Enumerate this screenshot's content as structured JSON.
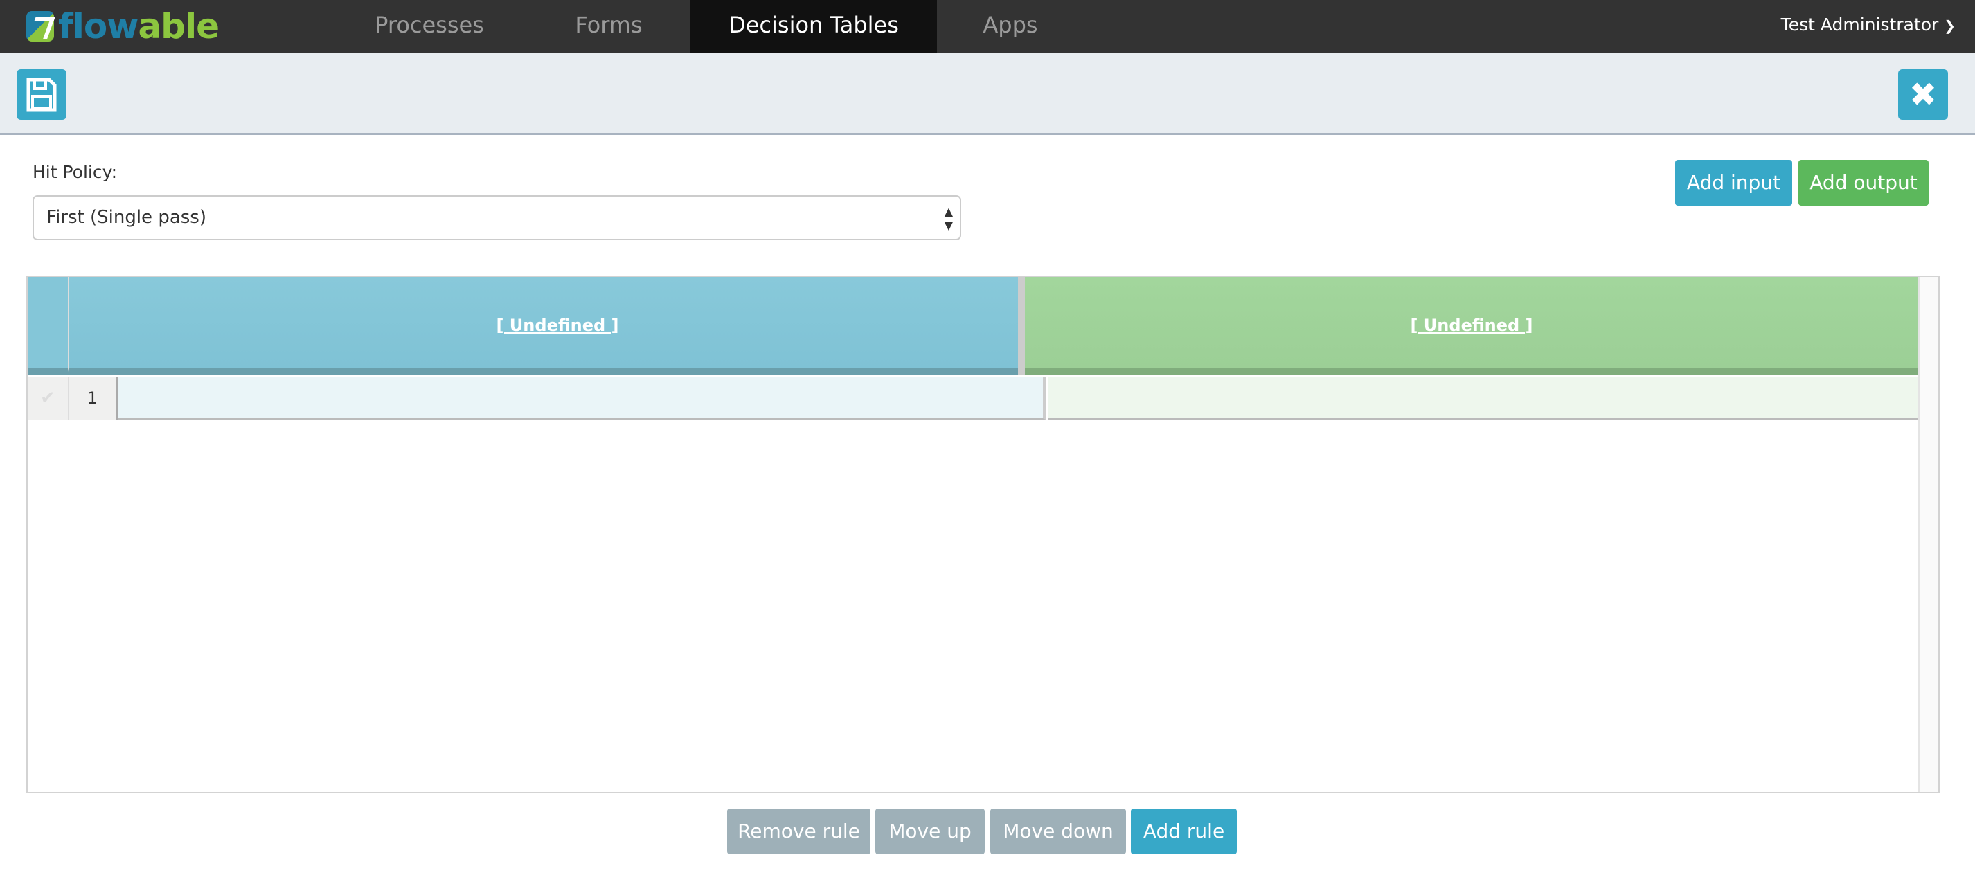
{
  "navbar": {
    "logo": "flowable",
    "items": [
      {
        "label": "Processes"
      },
      {
        "label": "Forms"
      },
      {
        "label": "Decision Tables",
        "active": true
      },
      {
        "label": "Apps"
      }
    ],
    "user": "Test Administrator"
  },
  "toolbar": {
    "save_icon": "floppy-disk-icon",
    "close_icon": "close-x-icon"
  },
  "hit_policy": {
    "label": "Hit Policy:",
    "value": "First (Single pass)"
  },
  "actions": {
    "add_input": "Add input",
    "add_output": "Add output"
  },
  "table": {
    "input_header": "[ Undefined ]",
    "output_header": "[ Undefined ]",
    "rows": [
      {
        "number": "1",
        "input": "",
        "output": ""
      }
    ]
  },
  "footer": {
    "remove_rule": "Remove rule",
    "move_up": "Move up",
    "move_down": "Move down",
    "add_rule": "Add rule"
  },
  "colors": {
    "accent_blue": "#37a8c8",
    "accent_green": "#5cb85c",
    "input_header": "#84c6d8",
    "output_header": "#9fd39a"
  }
}
